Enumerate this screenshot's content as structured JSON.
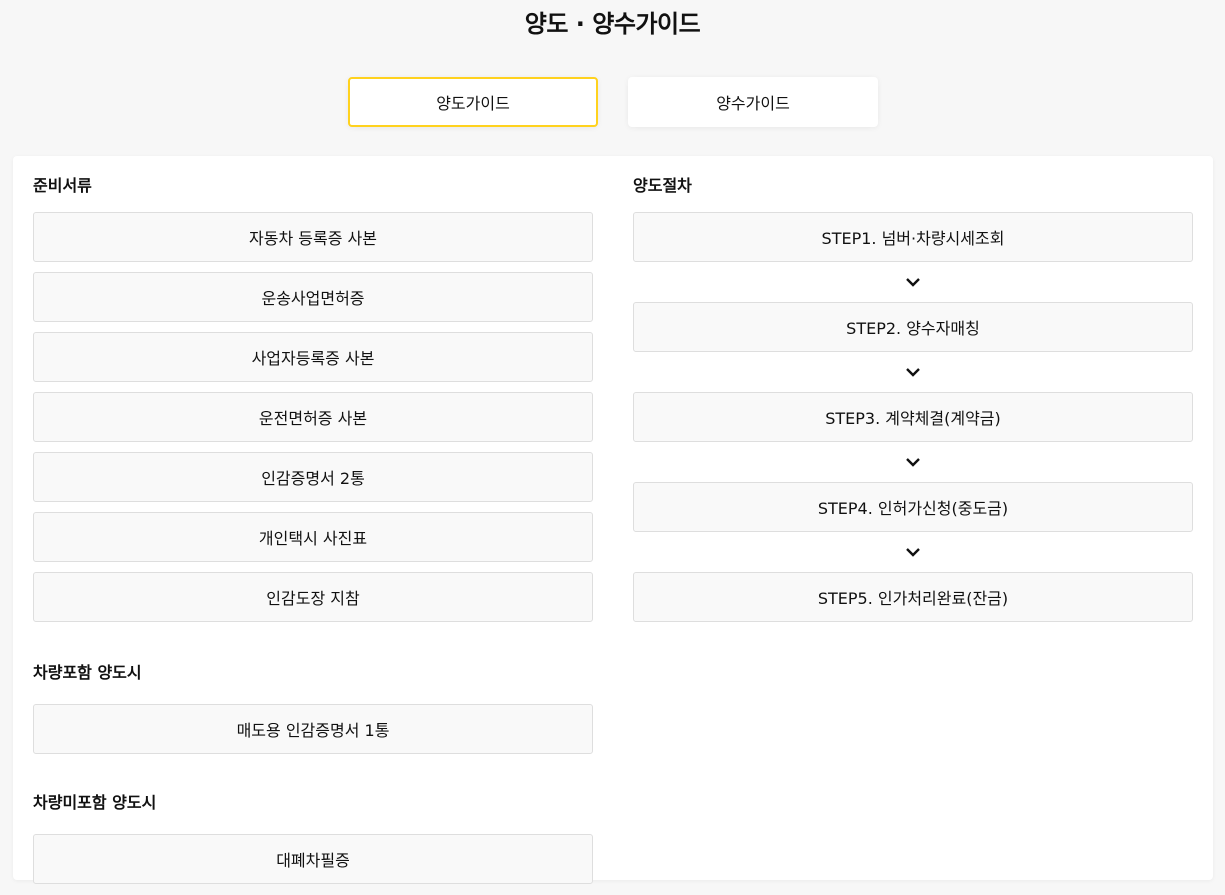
{
  "page_title": "양도 · 양수가이드",
  "tabs": [
    {
      "label": "양도가이드",
      "active": true
    },
    {
      "label": "양수가이드",
      "active": false
    }
  ],
  "accent_color": "#ffd21e",
  "documents": {
    "title": "준비서류",
    "items": [
      "자동차 등록증 사본",
      "운송사업면허증",
      "사업자등록증 사본",
      "운전면허증 사본",
      "인감증명서 2통",
      "개인택시 사진표",
      "인감도장 지참"
    ]
  },
  "with_vehicle": {
    "title": "차량포함 양도시",
    "items": [
      "매도용 인감증명서 1통"
    ]
  },
  "without_vehicle": {
    "title": "차량미포함 양도시",
    "items": [
      "대폐차필증"
    ]
  },
  "procedure": {
    "title": "양도절차",
    "steps": [
      "STEP1. 넘버·차량시세조회",
      "STEP2. 양수자매칭",
      "STEP3. 계약체결(계약금)",
      "STEP4. 인허가신청(중도금)",
      "STEP5. 인가처리완료(잔금)"
    ],
    "arrow_icon": "chevron-down-icon"
  }
}
